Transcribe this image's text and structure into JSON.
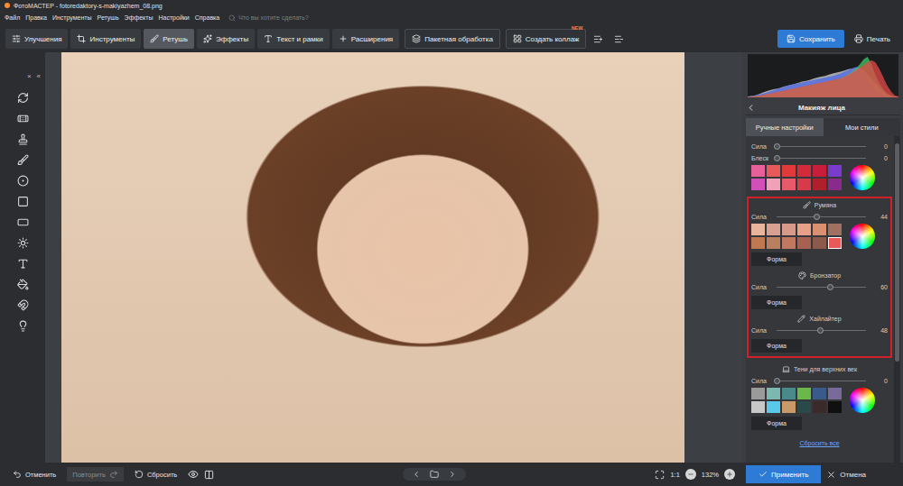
{
  "window": {
    "title": "ФотоМАСТЕР - fotoredaktory-s-makiyazhem_08.png"
  },
  "menu": [
    "Файл",
    "Правка",
    "Инструменты",
    "Ретушь",
    "Эффекты",
    "Настройки",
    "Справка"
  ],
  "search": {
    "placeholder": "Что вы хотите сделать?"
  },
  "toolbar": {
    "tabs": [
      {
        "label": "Улучшения",
        "selected": false
      },
      {
        "label": "Инструменты",
        "selected": false
      },
      {
        "label": "Ретушь",
        "selected": true
      },
      {
        "label": "Эффекты",
        "selected": false
      },
      {
        "label": "Текст и рамки",
        "selected": false
      },
      {
        "label": "Расширения",
        "selected": false
      }
    ],
    "batch": "Пакетная обработка",
    "collage": {
      "label": "Создать коллаж",
      "badge": "NEW"
    },
    "save": "Сохранить",
    "print": "Печать"
  },
  "left_panel": {
    "close": "×",
    "collapse": "«"
  },
  "histogram": {
    "series": [
      {
        "color": "#d8d8d8",
        "values": [
          2,
          3,
          5,
          8,
          12,
          15,
          18,
          20,
          22,
          25,
          28,
          30,
          32,
          35,
          38,
          40,
          42,
          45,
          48,
          50,
          52,
          55,
          58,
          60,
          62,
          65,
          68,
          70,
          72,
          70,
          65,
          55,
          45,
          35,
          25,
          15,
          8,
          4,
          2,
          1
        ]
      },
      {
        "color": "#4a68e8",
        "values": [
          2,
          3,
          5,
          7,
          9,
          12,
          15,
          18,
          21,
          24,
          27,
          30,
          32,
          34,
          36,
          38,
          40,
          42,
          44,
          46,
          48,
          50,
          52,
          55,
          58,
          62,
          66,
          70,
          74,
          70,
          60,
          45,
          30,
          18,
          10,
          5,
          3,
          1,
          0,
          0
        ]
      },
      {
        "color": "#44c864",
        "values": [
          1,
          2,
          3,
          4,
          5,
          7,
          9,
          11,
          13,
          15,
          17,
          19,
          21,
          23,
          25,
          27,
          29,
          31,
          33,
          35,
          37,
          39,
          41,
          43,
          46,
          50,
          55,
          62,
          70,
          80,
          92,
          98,
          80,
          55,
          35,
          20,
          10,
          4,
          2,
          1
        ]
      },
      {
        "color": "#e84848",
        "values": [
          1,
          2,
          3,
          4,
          6,
          8,
          10,
          12,
          14,
          16,
          18,
          20,
          22,
          24,
          26,
          28,
          30,
          32,
          34,
          36,
          38,
          40,
          42,
          44,
          46,
          50,
          54,
          60,
          66,
          72,
          78,
          84,
          90,
          85,
          70,
          50,
          30,
          15,
          5,
          2
        ]
      }
    ]
  },
  "panel": {
    "title": "Макияж лица",
    "tabs": [
      {
        "label": "Ручные настройки",
        "selected": true
      },
      {
        "label": "Мои стили",
        "selected": false
      }
    ],
    "groups": [
      {
        "highlighted": false,
        "sections": [
          {
            "sliders": [
              {
                "label": "Сила",
                "level": 0,
                "reading": "0"
              },
              {
                "label": "Блеск",
                "level": 0,
                "reading": "0"
              }
            ],
            "palette": [
              {
                "color": "#e8609a",
                "selected": false
              },
              {
                "color": "#e85a5a",
                "selected": false
              },
              {
                "color": "#e03a3a",
                "selected": false
              },
              {
                "color": "#d42a3a",
                "selected": false
              },
              {
                "color": "#c81e3c",
                "selected": false
              },
              {
                "color": "#7a3ccc",
                "selected": false
              },
              {
                "color": "#d04fb8",
                "selected": false
              },
              {
                "color": "#f0a0b8",
                "selected": false
              },
              {
                "color": "#e85a6a",
                "selected": false
              },
              {
                "color": "#d83a4a",
                "selected": false
              },
              {
                "color": "#b0202a",
                "selected": false
              },
              {
                "color": "#8a2a8a",
                "selected": false
              }
            ]
          }
        ]
      },
      {
        "highlighted": true,
        "sections": [
          {
            "title": "Румяна",
            "sliders": [
              {
                "label": "Сила",
                "level": 0.44,
                "reading": "44"
              }
            ],
            "palette": [
              {
                "color": "#e8b49c",
                "selected": false
              },
              {
                "color": "#d8a090",
                "selected": false
              },
              {
                "color": "#d89a88",
                "selected": false
              },
              {
                "color": "#e8a088",
                "selected": false
              },
              {
                "color": "#d89070",
                "selected": false
              },
              {
                "color": "#a07060",
                "selected": false
              },
              {
                "color": "#c07850",
                "selected": false
              },
              {
                "color": "#b88060",
                "selected": false
              },
              {
                "color": "#c07860",
                "selected": false
              },
              {
                "color": "#a86050",
                "selected": false
              },
              {
                "color": "#8c5a4a",
                "selected": false
              },
              {
                "color": "#e85a5a",
                "selected": true
              }
            ],
            "shape_button": "Форма"
          },
          {
            "title": "Бронзатор",
            "sliders": [
              {
                "label": "Сила",
                "level": 0.6,
                "reading": "60"
              }
            ],
            "shape_button": "Форма"
          },
          {
            "title": "Хайлайтер",
            "sliders": [
              {
                "label": "Сила",
                "level": 0.48,
                "reading": "48"
              }
            ],
            "shape_button": "Форма"
          }
        ]
      },
      {
        "highlighted": false,
        "sections": [
          {
            "title": "Тени для верхних век",
            "sliders": [
              {
                "label": "Сила",
                "level": 0,
                "reading": "0"
              }
            ],
            "palette": [
              {
                "color": "#9a9a9a",
                "selected": false
              },
              {
                "color": "#7ab8b0",
                "selected": false
              },
              {
                "color": "#4a8a8a",
                "selected": false
              },
              {
                "color": "#6ab84a",
                "selected": false
              },
              {
                "color": "#3a5a8a",
                "selected": false
              },
              {
                "color": "#7a6a9a",
                "selected": false
              },
              {
                "color": "#c8c8c8",
                "selected": false
              },
              {
                "color": "#5ac8e8",
                "selected": false
              },
              {
                "color": "#c89a6a",
                "selected": false
              },
              {
                "color": "#2a4a4a",
                "selected": false
              },
              {
                "color": "#3a2a2a",
                "selected": false
              },
              {
                "color": "#101010",
                "selected": false
              }
            ],
            "shape_button": "Форма"
          }
        ]
      }
    ],
    "reset": "Сбросить все"
  },
  "bottom_bar": {
    "undo": "Отменить",
    "redo": {
      "label": "Повторить",
      "disabled": true
    },
    "reset": "Сбросить",
    "zoom_fit": "1:1",
    "zoom": "132%",
    "apply": "Применить",
    "cancel": "Отмена"
  }
}
